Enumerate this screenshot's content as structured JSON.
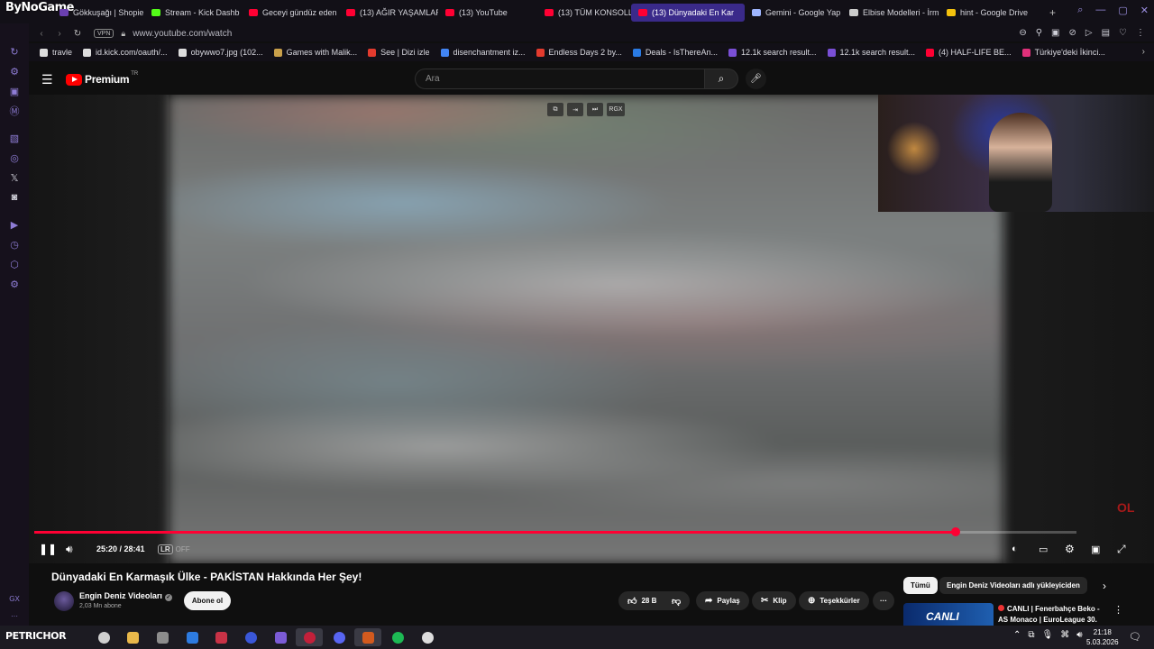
{
  "browser": {
    "brand": "ByNoGame",
    "tabs": [
      {
        "label": "Gökkuşağı | Shopier",
        "color": "#6a3fb0",
        "active": false,
        "width": 102
      },
      {
        "label": "Stream - Kick Dashb",
        "color": "#53fc18",
        "active": false,
        "width": 108
      },
      {
        "label": "Geceyi gündüz eden",
        "color": "#ff0033",
        "active": false,
        "width": 108
      },
      {
        "label": "(13) AĞIR YAŞAMLAR",
        "color": "#ff0033",
        "active": false,
        "width": 110
      },
      {
        "label": "(13) YouTube",
        "color": "#ff0033",
        "active": false,
        "width": 110
      },
      {
        "label": "(13) TÜM KONSOLLA",
        "color": "#ff0033",
        "active": false,
        "width": 104
      },
      {
        "label": "(13) Dünyadaki En Kar",
        "color": "#ff0033",
        "active": true,
        "width": 126
      },
      {
        "label": "Gemini - Google Yap",
        "color": "#9fb6ff",
        "active": false,
        "width": 108
      },
      {
        "label": "Elbise Modelleri - İrm",
        "color": "#cccccc",
        "active": false,
        "width": 108
      },
      {
        "label": "hint - Google Drive",
        "color": "#f4c20d",
        "active": false,
        "width": 108
      }
    ],
    "new_tab": "+",
    "url": "www.youtube.com/watch",
    "vpn_label": "VPN",
    "bookmarks": [
      {
        "label": "travle",
        "color": "#dddddd"
      },
      {
        "label": "id.kick.com/oauth/...",
        "color": "#dddddd"
      },
      {
        "label": "obywwo7.jpg (102...",
        "color": "#dddddd"
      },
      {
        "label": "Games with Malik...",
        "color": "#c9a04a"
      },
      {
        "label": "See | Dizi izle",
        "color": "#e33b2e"
      },
      {
        "label": "disenchantment iz...",
        "color": "#4285f4"
      },
      {
        "label": "Endless Days 2 by...",
        "color": "#e33b2e"
      },
      {
        "label": "Deals - IsThereAn...",
        "color": "#2a7be4"
      },
      {
        "label": "12.1k search result...",
        "color": "#7a4fd6"
      },
      {
        "label": "12.1k search result...",
        "color": "#7a4fd6"
      },
      {
        "label": "(4) HALF-LIFE BE...",
        "color": "#ff0033"
      },
      {
        "label": "Türkiye'deki İkinci...",
        "color": "#e0307a"
      }
    ]
  },
  "youtube": {
    "logo": "Premium",
    "region": "TR",
    "search_placeholder": "Ara",
    "player": {
      "current_time": "25:20",
      "duration": "28:41",
      "progress_fraction": 0.884,
      "lr_label": "LR",
      "lr_state": "OFF",
      "mini_label": "RGX",
      "watermark": "OL"
    },
    "video": {
      "title": "Dünyadaki En Karmaşık Ülke - PAKİSTAN Hakkında Her Şey!",
      "channel": "Engin Deniz Videoları",
      "subscribers": "2,03 Mn abone",
      "subscribe_label": "Abone ol",
      "likes": "28 B",
      "share_label": "Paylaş",
      "clip_label": "Klip",
      "thanks_label": "Teşekkürler"
    },
    "chips": [
      "Tümü",
      "Engin Deniz Videoları adlı yükleyiciden"
    ],
    "recommendation": {
      "thumb_text": "CANLI",
      "title": "CANLI | Fenerbahçe Beko - AS Monaco | EuroLeague 30. ..."
    }
  },
  "taskbar": {
    "label": "PETRICHOR",
    "time": "21:18",
    "date": "5.03.2026"
  }
}
